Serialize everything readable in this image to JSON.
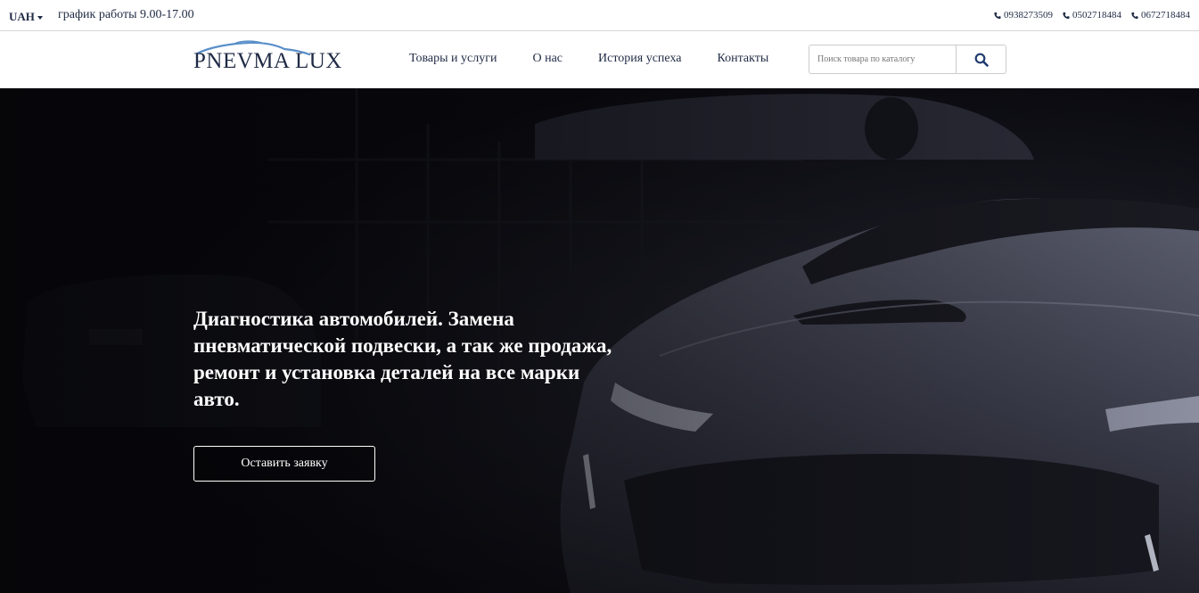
{
  "topbar": {
    "currency": "UAH",
    "schedule": "график работы 9.00-17.00",
    "phones": [
      "0938273509",
      "0502718484",
      "0672718484"
    ]
  },
  "header": {
    "logo": {
      "text_main": "PNEVMA",
      "text_second": "LUX"
    },
    "nav": [
      {
        "label": "Товары и услуги"
      },
      {
        "label": "О нас"
      },
      {
        "label": "История успеха"
      },
      {
        "label": "Контакты"
      }
    ],
    "search": {
      "placeholder": "Поиск товара по каталогу",
      "icon": "search-icon"
    }
  },
  "hero": {
    "title": "Диагностика автомобилей. Замена пневматической подвески, а так же продажа, ремонт и установка деталей на все марки авто.",
    "button_label": "Оставить заявку"
  },
  "colors": {
    "text_dark": "#1f2a44",
    "hero_bg": "#0b0b12",
    "logo_accent": "#5a8fc9",
    "white": "#ffffff"
  }
}
